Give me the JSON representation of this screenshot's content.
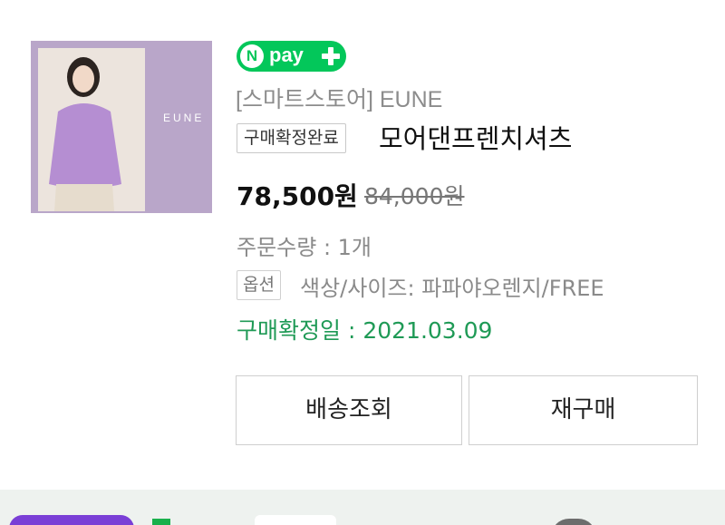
{
  "product": {
    "thumbnail_brand_mark": "EUNE",
    "store_label": "[스마트스토어] EUNE",
    "status_badge": "구매확정완료",
    "name": "모어댄프렌치셔츠",
    "price": "78,500원",
    "original_price": "84,000원"
  },
  "npay": {
    "badge_letter": "N",
    "badge_word": "pay",
    "icon": "plus-icon",
    "color": "#03c75a"
  },
  "order": {
    "quantity_text": "주문수량 : 1개",
    "option_badge": "옵션",
    "option_text": "색상/사이즈: 파파야오렌지/FREE",
    "confirm_date_text": "구매확정일 : 2021.03.09"
  },
  "actions": {
    "track_label": "배송조회",
    "rebuy_label": "재구매"
  },
  "colors": {
    "confirm_green": "#1f9a56",
    "thumbnail_bg": "#b9a6c9"
  }
}
